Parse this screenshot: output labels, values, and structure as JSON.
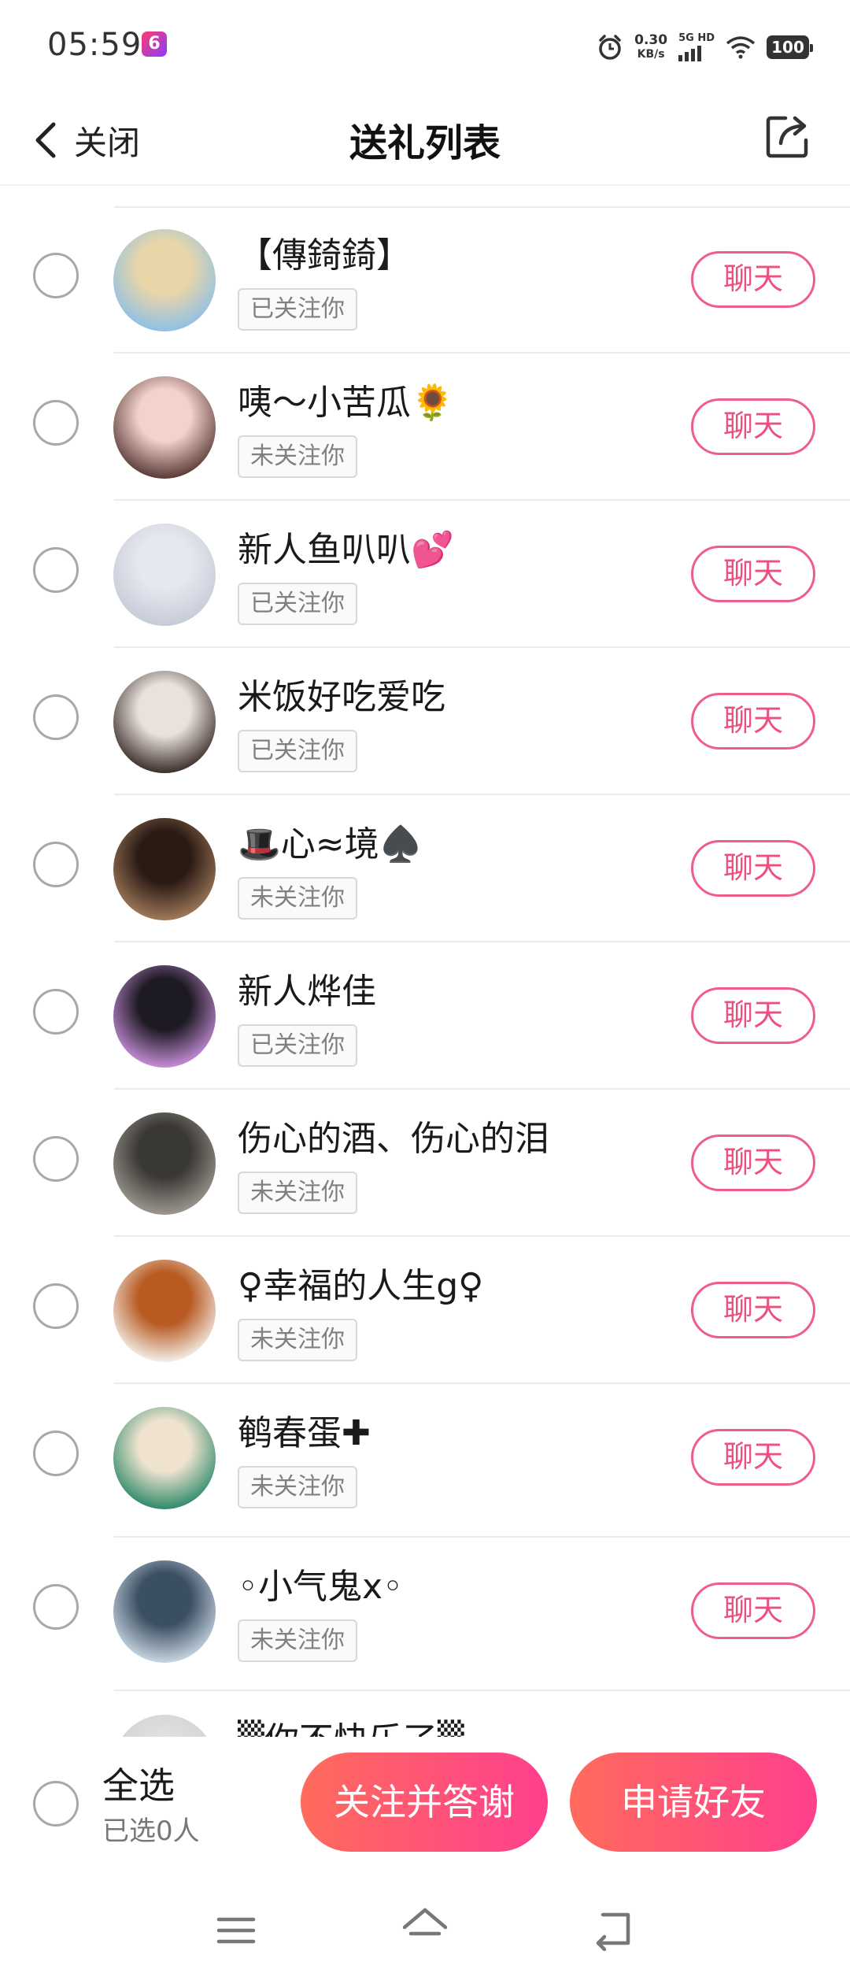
{
  "status_bar": {
    "time": "05:59",
    "app_badge": "6",
    "speed_value": "0.30",
    "speed_unit": "KB/s",
    "network": "5G HD",
    "battery": "100"
  },
  "header": {
    "back_label": "关闭",
    "title": "送礼列表",
    "share_icon": "share-icon"
  },
  "users": [
    {
      "name": "【傳錡錡】",
      "status": "已关注你",
      "chat_label": "聊天",
      "avatar_colors": [
        "#e9d6a8",
        "#8fc0e6"
      ]
    },
    {
      "name": "咦～小苦瓜🌻",
      "status": "未关注你",
      "chat_label": "聊天",
      "avatar_colors": [
        "#f3d2cc",
        "#5a3a36"
      ]
    },
    {
      "name": "新人鱼叭叭💕",
      "status": "已关注你",
      "chat_label": "聊天",
      "avatar_colors": [
        "#e6e8ef",
        "#c7cbd8"
      ]
    },
    {
      "name": "米饭好吃爱吃",
      "status": "已关注你",
      "chat_label": "聊天",
      "avatar_colors": [
        "#e8e1dc",
        "#3b2d2a"
      ]
    },
    {
      "name": "🎩心≈境♠️",
      "status": "未关注你",
      "chat_label": "聊天",
      "avatar_colors": [
        "#2a1a14",
        "#a07a5a"
      ]
    },
    {
      "name": "新人烨佳",
      "status": "已关注你",
      "chat_label": "聊天",
      "avatar_colors": [
        "#1e1a24",
        "#c68ed8"
      ]
    },
    {
      "name": "伤心的酒、伤心的泪",
      "status": "未关注你",
      "chat_label": "聊天",
      "avatar_colors": [
        "#3a3835",
        "#9c9890"
      ]
    },
    {
      "name": "♀幸福的人生g♀",
      "status": "未关注你",
      "chat_label": "聊天",
      "avatar_colors": [
        "#b85a22",
        "#f4efe8"
      ]
    },
    {
      "name": "鹌春蛋✚",
      "status": "未关注你",
      "chat_label": "聊天",
      "avatar_colors": [
        "#efe3cf",
        "#2e8a6a"
      ]
    },
    {
      "name": "◦小气鬼x◦",
      "status": "未关注你",
      "chat_label": "聊天",
      "avatar_colors": [
        "#3b4f62",
        "#c9d6e3"
      ]
    }
  ],
  "partial_row": {
    "name": "▒你不快乐了▒"
  },
  "bottom_bar": {
    "select_all": "全选",
    "selected_count": "已选0人",
    "follow_thank_label": "关注并答谢",
    "add_friend_label": "申请好友"
  },
  "colors": {
    "accent_pink": "#ee4f7e",
    "gradient_start": "#ff6b5c",
    "gradient_end": "#ff3f8e"
  }
}
